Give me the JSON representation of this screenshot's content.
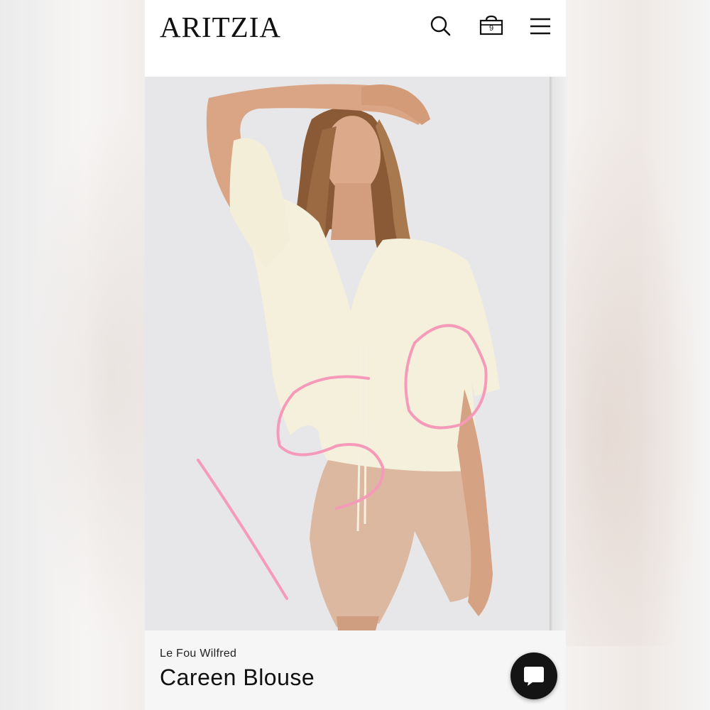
{
  "header": {
    "logo_text": "ARITZIA",
    "cart_count": "9",
    "icons": [
      "search-icon",
      "shopping-bag-icon",
      "menu-icon"
    ]
  },
  "product": {
    "brand": "Le Fou Wilfred",
    "name": "Careen Blouse"
  },
  "image": {
    "description_icon": "product-photo",
    "annotation_color": "#f59ab9"
  },
  "colors": {
    "accent": "#f59ab9",
    "text": "#111111",
    "chat_button": "#141414"
  }
}
